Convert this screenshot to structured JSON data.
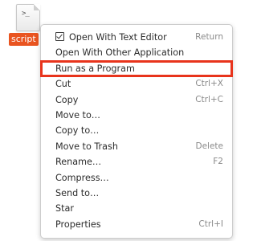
{
  "file": {
    "icon_glyph": ">_",
    "name": "script"
  },
  "menu": {
    "items": [
      {
        "label": "Open With Text Editor",
        "accel": "Return"
      },
      {
        "label": "Open With Other Application",
        "accel": ""
      },
      {
        "label": "Run as a Program",
        "accel": ""
      },
      {
        "label": "Cut",
        "accel": "Ctrl+X"
      },
      {
        "label": "Copy",
        "accel": "Ctrl+C"
      },
      {
        "label": "Move to…",
        "accel": ""
      },
      {
        "label": "Copy to…",
        "accel": ""
      },
      {
        "label": "Move to Trash",
        "accel": "Delete"
      },
      {
        "label": "Rename…",
        "accel": "F2"
      },
      {
        "label": "Compress…",
        "accel": ""
      },
      {
        "label": "Send to…",
        "accel": ""
      },
      {
        "label": "Star",
        "accel": ""
      },
      {
        "label": "Properties",
        "accel": "Ctrl+I"
      }
    ]
  },
  "colors": {
    "selection_label_bg": "#e95420",
    "highlight_outline": "#e8341c"
  }
}
